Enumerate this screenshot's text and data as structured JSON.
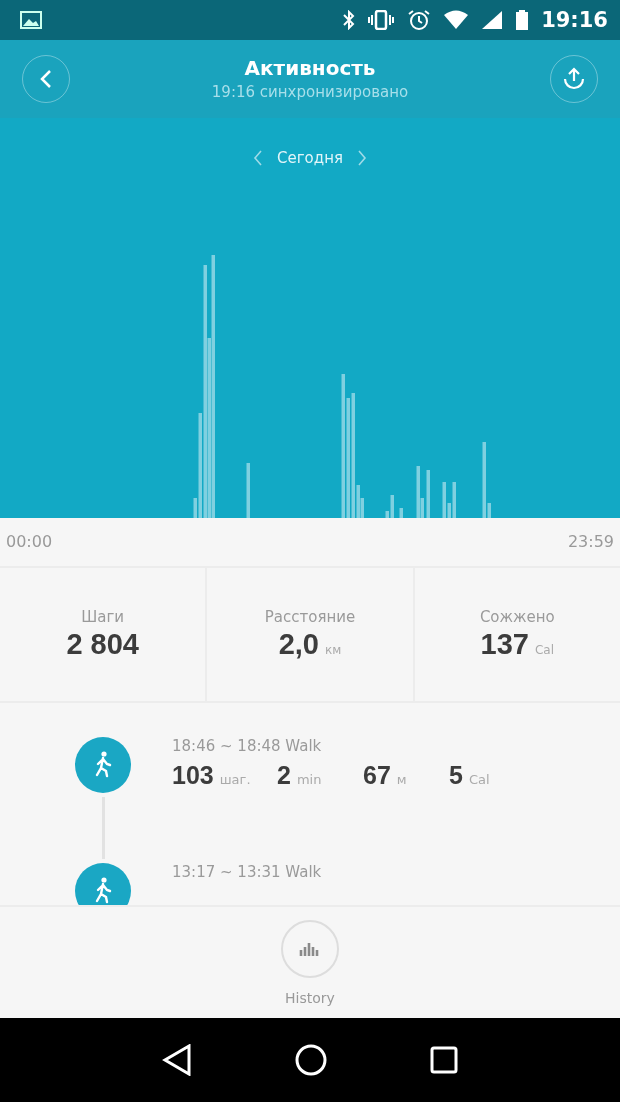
{
  "status_bar": {
    "time": "19:16"
  },
  "header": {
    "title": "Активность",
    "subtitle": "19:16 синхронизировано"
  },
  "chart": {
    "period": "Сегодня",
    "start_label": "00:00",
    "end_label": "23:59"
  },
  "stats": [
    {
      "label": "Шаги",
      "value": "2 804"
    },
    {
      "label": "Расстояние",
      "value": "2,0",
      "unit": "км"
    },
    {
      "label": "Сожжено",
      "value": "137",
      "unit": "Cal"
    }
  ],
  "activities": [
    {
      "title": "18:46 ~ 18:48 Walk",
      "metrics": [
        {
          "value": "103",
          "unit": "шаг."
        },
        {
          "value": "2",
          "unit": "min"
        },
        {
          "value": "67",
          "unit": "м"
        },
        {
          "value": "5",
          "unit": "Cal"
        }
      ]
    },
    {
      "title": "13:17 ~ 13:31 Walk"
    }
  ],
  "bottom": {
    "label": "History"
  }
}
